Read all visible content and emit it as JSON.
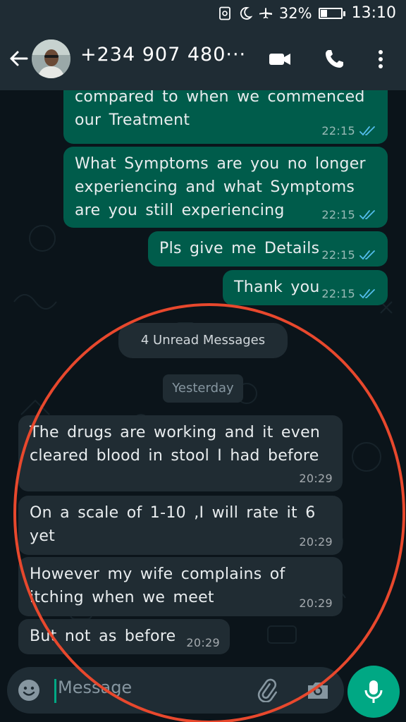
{
  "status_bar": {
    "battery_percent": "32%",
    "battery_level": 0.32,
    "time": "13:10",
    "icons": [
      "sim-icon",
      "moon-icon",
      "airplane-icon",
      "battery-icon"
    ]
  },
  "header": {
    "contact_name": "+234 907 480···",
    "icons": [
      "back-arrow-icon",
      "avatar",
      "video-call-icon",
      "phone-icon",
      "more-vert-icon"
    ]
  },
  "messages": [
    {
      "direction": "outgoing",
      "text": "compared to when we commenced our Treatment",
      "time": "22:15",
      "status": "read"
    },
    {
      "direction": "outgoing",
      "text": "What Symptoms are you no longer experiencing and what Symptoms are you still experiencing",
      "time": "22:15",
      "status": "read"
    },
    {
      "direction": "outgoing",
      "text": "Pls give me Details",
      "time": "22:15",
      "status": "read"
    },
    {
      "direction": "outgoing",
      "text": "Thank you",
      "time": "22:15",
      "status": "read"
    },
    {
      "direction": "incoming",
      "text": "The drugs are working and it even cleared blood in stool I had before",
      "time": "20:29"
    },
    {
      "direction": "incoming",
      "text": "On a scale of 1-10 ,I will rate it 6 yet",
      "time": "20:29"
    },
    {
      "direction": "incoming",
      "text": "However my wife complains of itching when we meet",
      "time": "20:29"
    },
    {
      "direction": "incoming",
      "text": "But not as before",
      "time": "20:29"
    }
  ],
  "unread_banner": "4 Unread Messages",
  "date_divider": "Yesterday",
  "composer": {
    "placeholder": "Message",
    "icons": [
      "emoji-icon",
      "attach-icon",
      "camera-icon",
      "mic-icon"
    ]
  },
  "colors": {
    "background": "#0b141a",
    "header": "#1f2c34",
    "outgoing_bubble": "#005c4b",
    "incoming_bubble": "#202c33",
    "accent": "#00a884",
    "read_ticks": "#53bdeb",
    "annotation_circle": "#e8482d"
  }
}
